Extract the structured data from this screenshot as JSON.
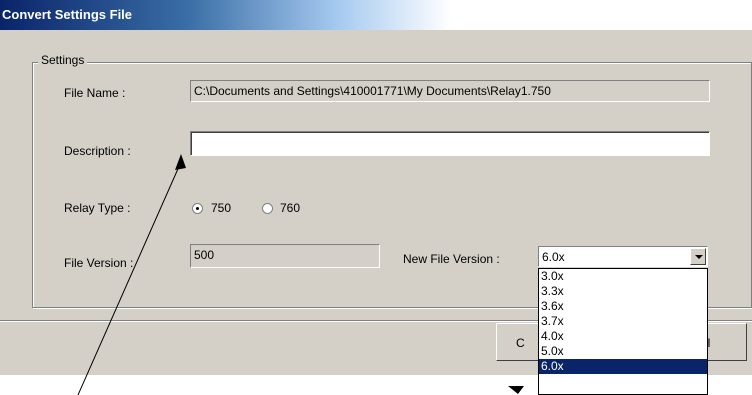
{
  "window": {
    "title": "Convert Settings File"
  },
  "settings": {
    "group_label": "Settings",
    "file_name_label": "File Name :",
    "file_name_value": "C:\\Documents and Settings\\410001771\\My Documents\\Relay1.750",
    "description_label": "Description :",
    "description_value": "",
    "relay_type_label": "Relay Type :",
    "relay_options": [
      "750",
      "760"
    ],
    "relay_selected": "750",
    "file_version_label": "File Version :",
    "file_version_value": "500",
    "new_file_version_label": "New File Version :",
    "new_file_version_value": "6.0x",
    "version_options": [
      "3.0x",
      "3.3x",
      "3.6x",
      "3.7x",
      "4.0x",
      "5.0x",
      "6.0x"
    ],
    "version_selected": "6.0x"
  },
  "buttons": {
    "convert_partial": "C",
    "cancel_partial": "el"
  }
}
